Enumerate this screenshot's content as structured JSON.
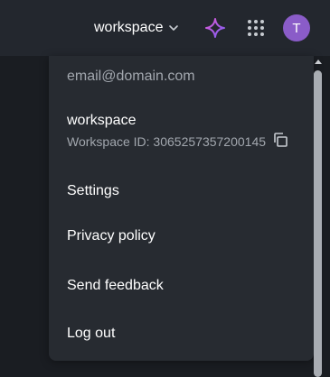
{
  "header": {
    "workspace_label": "workspace",
    "avatar_initial": "T"
  },
  "menu": {
    "email": "email@domain.com",
    "workspace_name": "workspace",
    "workspace_id_label": "Workspace ID: 3065257357200145",
    "items": [
      {
        "label": "Settings"
      },
      {
        "label": "Privacy policy"
      },
      {
        "label": "Send feedback"
      },
      {
        "label": "Log out"
      }
    ]
  },
  "colors": {
    "accent_sparkle_start": "#d946ef",
    "accent_sparkle_end": "#6366f1",
    "avatar_bg": "#8a5cc8",
    "menu_bg": "#272b31"
  },
  "icons": [
    "chevron-down-icon",
    "sparkle-icon",
    "apps-grid-icon",
    "copy-icon",
    "scroll-up-arrow-icon"
  ]
}
